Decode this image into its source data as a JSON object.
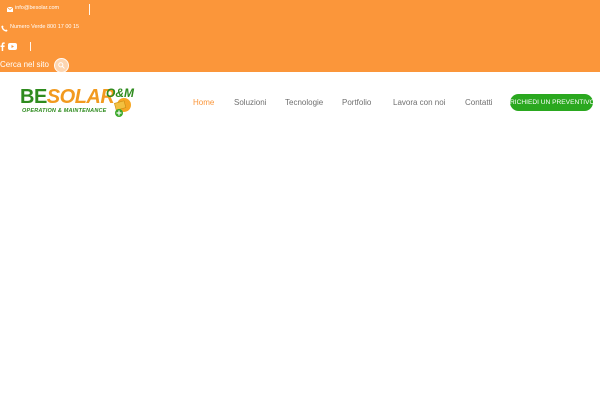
{
  "topbar": {
    "email": "info@besolar.com",
    "phone": "Numero Verde 800 17 00 15",
    "search_label": "Cerca nel sito",
    "bg_color": "#fb963a"
  },
  "icons": {
    "email": "envelope-icon",
    "phone": "phone-icon",
    "facebook": "facebook-icon",
    "youtube": "youtube-icon",
    "search": "search-icon"
  },
  "logo": {
    "be": "BE",
    "solar": "SOLAR",
    "om": "O&M",
    "subtitle": "OPERATION & MAINTENANCE"
  },
  "nav": {
    "items": [
      {
        "label": "Home",
        "active": true
      },
      {
        "label": "Soluzioni",
        "active": false
      },
      {
        "label": "Tecnologie",
        "active": false
      },
      {
        "label": "Portfolio",
        "active": false
      },
      {
        "label": "Lavora con noi",
        "active": false
      },
      {
        "label": "Contatti",
        "active": false
      }
    ],
    "cta_label": "RICHIEDI UN PREVENTIVO",
    "active_color": "#fb963a",
    "cta_color": "#2aa81f"
  }
}
